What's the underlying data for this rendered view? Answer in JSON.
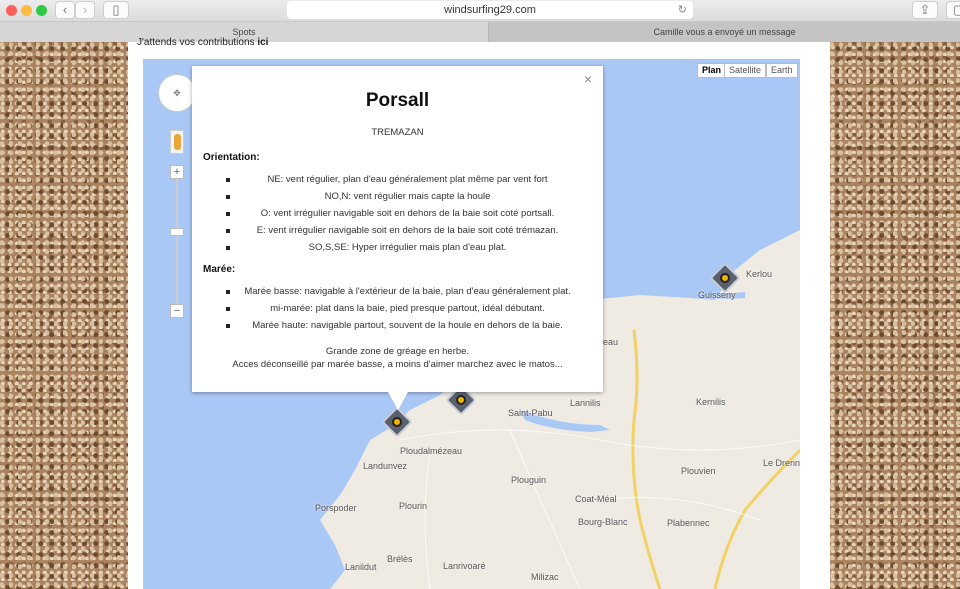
{
  "browser": {
    "url": "windsurfing29.com",
    "tabs": [
      {
        "label": "Spots",
        "active": true
      },
      {
        "label": "Camille vous a envoyé un message",
        "active": false
      }
    ]
  },
  "page": {
    "contrib_text": "J'attends vos contributions ",
    "contrib_link": "ici"
  },
  "map": {
    "map_types": [
      "Plan",
      "Satellite",
      "Earth"
    ],
    "selected_type": "Plan",
    "places": [
      "Kerlou",
      "Guisseny",
      "Plouguerneau",
      "Lannilis",
      "Kernilis",
      "Saint-Pabu",
      "Ploudalmézeau",
      "Landunvez",
      "Plouguin",
      "Coat-Méal",
      "Plouvien",
      "Le Drenne",
      "Porspoder",
      "Plourin",
      "Bourg-Blanc",
      "Plabennec",
      "Brélès",
      "Lanildut",
      "Lanrivoaré",
      "Milizac"
    ],
    "colors": {
      "water": "#a9c8f6",
      "land": "#efebe3",
      "road": "#f2d264",
      "marker": "#f2b500"
    }
  },
  "popup": {
    "close": "×",
    "title": "Porsall",
    "subtitle": "TREMAZAN",
    "orientation_heading": "Orientation:",
    "orientation": [
      "NE: vent régulier, plan d'eau généralement plat même par vent fort",
      "NO,N: vent régulier mais capte la houle",
      "O: vent irrégulier navigable soit en dehors de la baie soit coté portsall.",
      "E: vent irrégulier navigable soit en dehors de la baie soit coté trémazan.",
      "SO,S,SE: Hyper irrégulier mais plan d'eau plat."
    ],
    "maree_heading": "Marée:",
    "maree": [
      "Marée basse: navigable à l'extérieur de la baie, plan d'eau généralement plat.",
      "mi-marée: plat dans la baie, pied presque partout, idéal débutant.",
      "Marée haute: navigable partout, souvent de la houle en dehors de la baie."
    ],
    "footer1": "Grande zone de gréage en herbe.",
    "footer2": "Acces déconseillé par marée basse, a moins d'aimer marchez avec le matos..."
  }
}
